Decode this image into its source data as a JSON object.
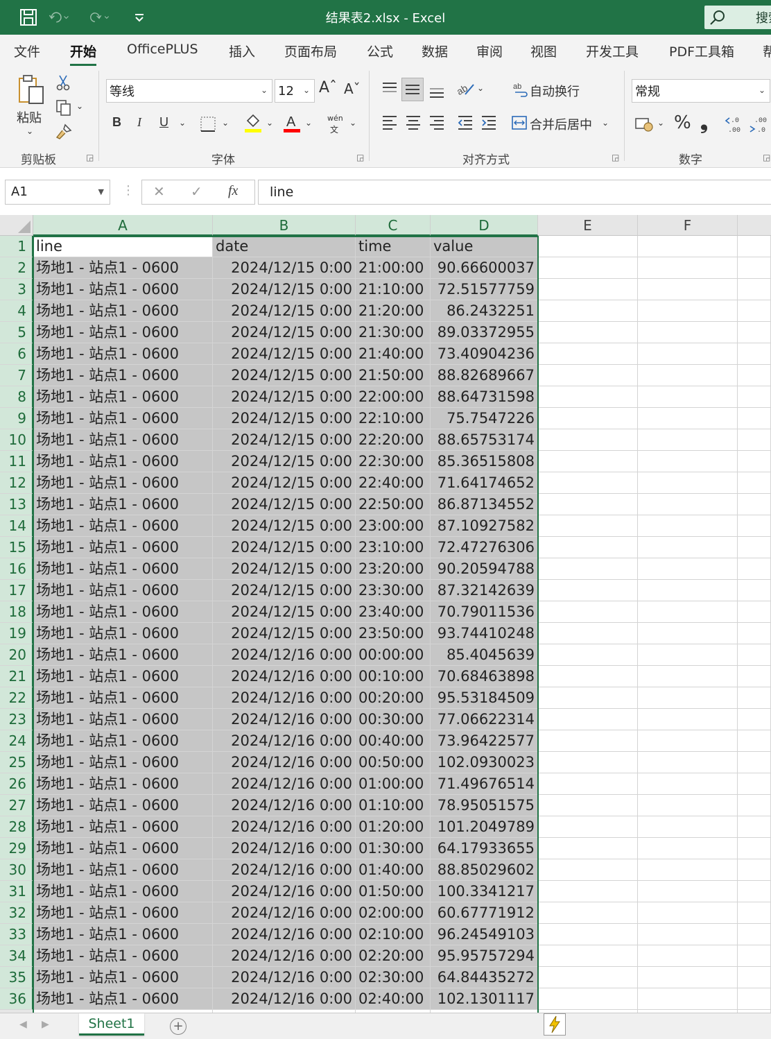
{
  "window": {
    "title": "结果表2.xlsx  -  Excel",
    "search_label": "搜索"
  },
  "menu": {
    "tabs": [
      "文件",
      "开始",
      "OfficePLUS",
      "插入",
      "页面布局",
      "公式",
      "数据",
      "审阅",
      "视图",
      "开发工具",
      "PDF工具箱",
      "帮"
    ],
    "active": "开始"
  },
  "ribbon": {
    "clipboard": {
      "paste_label": "粘贴",
      "group_label": "剪贴板"
    },
    "font": {
      "name": "等线",
      "size": "12",
      "bold": "B",
      "italic": "I",
      "underline": "U",
      "phonetic": "wén",
      "group_label": "字体",
      "highlight_color": "#ffff00",
      "font_color": "#ff0000"
    },
    "alignment": {
      "wrap_label": "自动换行",
      "merge_label": "合并后居中",
      "group_label": "对齐方式"
    },
    "number": {
      "format": "常规",
      "percent": "%",
      "comma": "❟",
      "group_label": "数字"
    }
  },
  "formula_bar": {
    "name_box": "A1",
    "fx_label": "fx",
    "content": "line"
  },
  "grid": {
    "columns": [
      "A",
      "B",
      "C",
      "D",
      "E",
      "F"
    ],
    "header": [
      "line",
      "date",
      "time",
      "value"
    ],
    "rows": [
      [
        "场地1 - 站点1 - 0600",
        "2024/12/15 0:00",
        "21:00:00",
        "90.66600037"
      ],
      [
        "场地1 - 站点1 - 0600",
        "2024/12/15 0:00",
        "21:10:00",
        "72.51577759"
      ],
      [
        "场地1 - 站点1 - 0600",
        "2024/12/15 0:00",
        "21:20:00",
        "86.2432251"
      ],
      [
        "场地1 - 站点1 - 0600",
        "2024/12/15 0:00",
        "21:30:00",
        "89.03372955"
      ],
      [
        "场地1 - 站点1 - 0600",
        "2024/12/15 0:00",
        "21:40:00",
        "73.40904236"
      ],
      [
        "场地1 - 站点1 - 0600",
        "2024/12/15 0:00",
        "21:50:00",
        "88.82689667"
      ],
      [
        "场地1 - 站点1 - 0600",
        "2024/12/15 0:00",
        "22:00:00",
        "88.64731598"
      ],
      [
        "场地1 - 站点1 - 0600",
        "2024/12/15 0:00",
        "22:10:00",
        "75.7547226"
      ],
      [
        "场地1 - 站点1 - 0600",
        "2024/12/15 0:00",
        "22:20:00",
        "88.65753174"
      ],
      [
        "场地1 - 站点1 - 0600",
        "2024/12/15 0:00",
        "22:30:00",
        "85.36515808"
      ],
      [
        "场地1 - 站点1 - 0600",
        "2024/12/15 0:00",
        "22:40:00",
        "71.64174652"
      ],
      [
        "场地1 - 站点1 - 0600",
        "2024/12/15 0:00",
        "22:50:00",
        "86.87134552"
      ],
      [
        "场地1 - 站点1 - 0600",
        "2024/12/15 0:00",
        "23:00:00",
        "87.10927582"
      ],
      [
        "场地1 - 站点1 - 0600",
        "2024/12/15 0:00",
        "23:10:00",
        "72.47276306"
      ],
      [
        "场地1 - 站点1 - 0600",
        "2024/12/15 0:00",
        "23:20:00",
        "90.20594788"
      ],
      [
        "场地1 - 站点1 - 0600",
        "2024/12/15 0:00",
        "23:30:00",
        "87.32142639"
      ],
      [
        "场地1 - 站点1 - 0600",
        "2024/12/15 0:00",
        "23:40:00",
        "70.79011536"
      ],
      [
        "场地1 - 站点1 - 0600",
        "2024/12/15 0:00",
        "23:50:00",
        "93.74410248"
      ],
      [
        "场地1 - 站点1 - 0600",
        "2024/12/16 0:00",
        "00:00:00",
        "85.4045639"
      ],
      [
        "场地1 - 站点1 - 0600",
        "2024/12/16 0:00",
        "00:10:00",
        "70.68463898"
      ],
      [
        "场地1 - 站点1 - 0600",
        "2024/12/16 0:00",
        "00:20:00",
        "95.53184509"
      ],
      [
        "场地1 - 站点1 - 0600",
        "2024/12/16 0:00",
        "00:30:00",
        "77.06622314"
      ],
      [
        "场地1 - 站点1 - 0600",
        "2024/12/16 0:00",
        "00:40:00",
        "73.96422577"
      ],
      [
        "场地1 - 站点1 - 0600",
        "2024/12/16 0:00",
        "00:50:00",
        "102.0930023"
      ],
      [
        "场地1 - 站点1 - 0600",
        "2024/12/16 0:00",
        "01:00:00",
        "71.49676514"
      ],
      [
        "场地1 - 站点1 - 0600",
        "2024/12/16 0:00",
        "01:10:00",
        "78.95051575"
      ],
      [
        "场地1 - 站点1 - 0600",
        "2024/12/16 0:00",
        "01:20:00",
        "101.2049789"
      ],
      [
        "场地1 - 站点1 - 0600",
        "2024/12/16 0:00",
        "01:30:00",
        "64.17933655"
      ],
      [
        "场地1 - 站点1 - 0600",
        "2024/12/16 0:00",
        "01:40:00",
        "88.85029602"
      ],
      [
        "场地1 - 站点1 - 0600",
        "2024/12/16 0:00",
        "01:50:00",
        "100.3341217"
      ],
      [
        "场地1 - 站点1 - 0600",
        "2024/12/16 0:00",
        "02:00:00",
        "60.67771912"
      ],
      [
        "场地1 - 站点1 - 0600",
        "2024/12/16 0:00",
        "02:10:00",
        "96.24549103"
      ],
      [
        "场地1 - 站点1 - 0600",
        "2024/12/16 0:00",
        "02:20:00",
        "95.95757294"
      ],
      [
        "场地1 - 站点1 - 0600",
        "2024/12/16 0:00",
        "02:30:00",
        "64.84435272"
      ],
      [
        "场地1 - 站点1 - 0600",
        "2024/12/16 0:00",
        "02:40:00",
        "102.1301117"
      ]
    ]
  },
  "sheets": {
    "tabs": [
      "Sheet1"
    ],
    "add_label": "+"
  },
  "colors": {
    "accent": "#217346",
    "selection_fill": "#c6c6c6",
    "selected_header": "#d2e7d9"
  }
}
